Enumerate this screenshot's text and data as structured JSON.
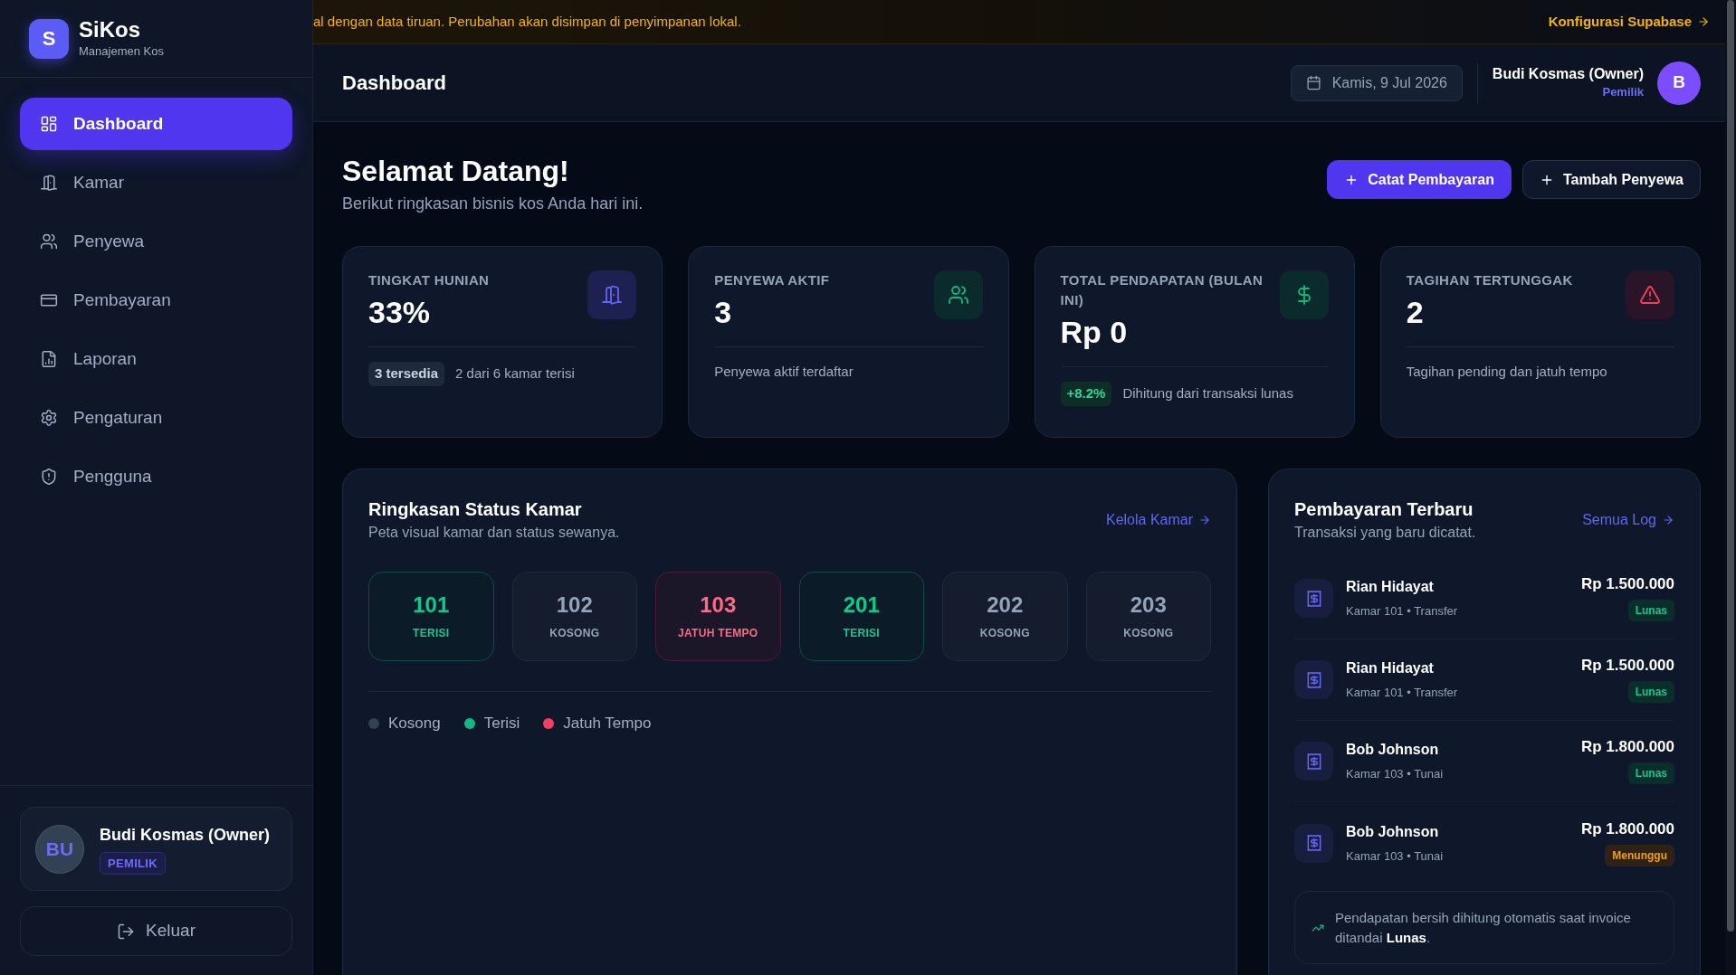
{
  "sidebar": {
    "brand": {
      "logo_letter": "S",
      "name": "SiKos",
      "tagline": "Manajemen Kos"
    },
    "nav_items": [
      {
        "label": "Dashboard",
        "selected": true
      },
      {
        "label": "Kamar",
        "selected": false
      },
      {
        "label": "Penyewa",
        "selected": false
      },
      {
        "label": "Pembayaran",
        "selected": false
      },
      {
        "label": "Laporan",
        "selected": false
      },
      {
        "label": "Pengaturan",
        "selected": false
      },
      {
        "label": "Pengguna",
        "selected": false
      }
    ],
    "user": {
      "initials": "BU",
      "name": "Budi Kosmas (Owner)",
      "role": "PEMILIK"
    },
    "logout_button": {
      "label": "Keluar"
    }
  },
  "banner": {
    "message": "al dengan data tiruan. Perubahan akan disimpan di penyimpanan lokal.",
    "link": "Konfigurasi Supabase"
  },
  "header": {
    "title": "Dashboard",
    "date": "Kamis, 9 Jul 2026",
    "user": {
      "name": "Budi Kosmas (Owner)",
      "role": "Pemilik",
      "initial": "B"
    }
  },
  "welcome": {
    "title": "Selamat Datang!",
    "subtitle": "Berikut ringkasan bisnis kos Anda hari ini.",
    "buttons": [
      {
        "label": "Catat Pembayaran",
        "kind": "primary"
      },
      {
        "label": "Tambah Penyewa",
        "kind": "secondary"
      }
    ]
  },
  "stat_cards": [
    {
      "label": "TINGKAT HUNIAN",
      "value": "33%",
      "badge": {
        "text": "3 tersedia",
        "kind": "neutral"
      },
      "note": "2 dari 6 kamar terisi"
    },
    {
      "label": "PENYEWA AKTIF",
      "value": "3",
      "note": "Penyewa aktif terdaftar"
    },
    {
      "label": "TOTAL PENDAPATAN (BULAN INI)",
      "value": "Rp 0",
      "badge": {
        "text": "+8.2%",
        "kind": "positive"
      },
      "note": "Dihitung dari transaksi lunas"
    },
    {
      "label": "TAGIHAN TERTUNGGAK",
      "value": "2",
      "note": "Tagihan pending dan jatuh tempo"
    }
  ],
  "room_status": {
    "title": "Ringkasan Status Kamar",
    "subtitle": "Peta visual kamar dan status sewanya.",
    "link": "Kelola Kamar",
    "rooms": [
      {
        "number": "101",
        "status": "TERISI",
        "kind": "occupied"
      },
      {
        "number": "102",
        "status": "KOSONG",
        "kind": "vacant"
      },
      {
        "number": "103",
        "status": "JATUH TEMPO",
        "kind": "overdue"
      },
      {
        "number": "201",
        "status": "TERISI",
        "kind": "occupied"
      },
      {
        "number": "202",
        "status": "KOSONG",
        "kind": "vacant"
      },
      {
        "number": "203",
        "status": "KOSONG",
        "kind": "vacant"
      }
    ],
    "legend": [
      {
        "label": "Kosong",
        "color": "#334155"
      },
      {
        "label": "Terisi",
        "color": "#10b981"
      },
      {
        "label": "Jatuh Tempo",
        "color": "#f43f5e"
      }
    ]
  },
  "recent_payments": {
    "title": "Pembayaran Terbaru",
    "subtitle": "Transaksi yang baru dicatat.",
    "link": "Semua Log",
    "items": [
      {
        "name": "Rian Hidayat",
        "detail": "Kamar 101 • Transfer",
        "amount": "Rp 1.500.000",
        "status": {
          "label": "Lunas",
          "kind": "paid"
        }
      },
      {
        "name": "Rian Hidayat",
        "detail": "Kamar 101 • Transfer",
        "amount": "Rp 1.500.000",
        "status": {
          "label": "Lunas",
          "kind": "paid"
        }
      },
      {
        "name": "Bob Johnson",
        "detail": "Kamar 103 • Tunai",
        "amount": "Rp 1.800.000",
        "status": {
          "label": "Lunas",
          "kind": "paid"
        }
      },
      {
        "name": "Bob Johnson",
        "detail": "Kamar 103 • Tunai",
        "amount": "Rp 1.800.000",
        "status": {
          "label": "Menunggu",
          "kind": "pending"
        }
      }
    ],
    "note": "Pendapatan bersih dihitung otomatis saat invoice ditandai **Lunas**."
  }
}
